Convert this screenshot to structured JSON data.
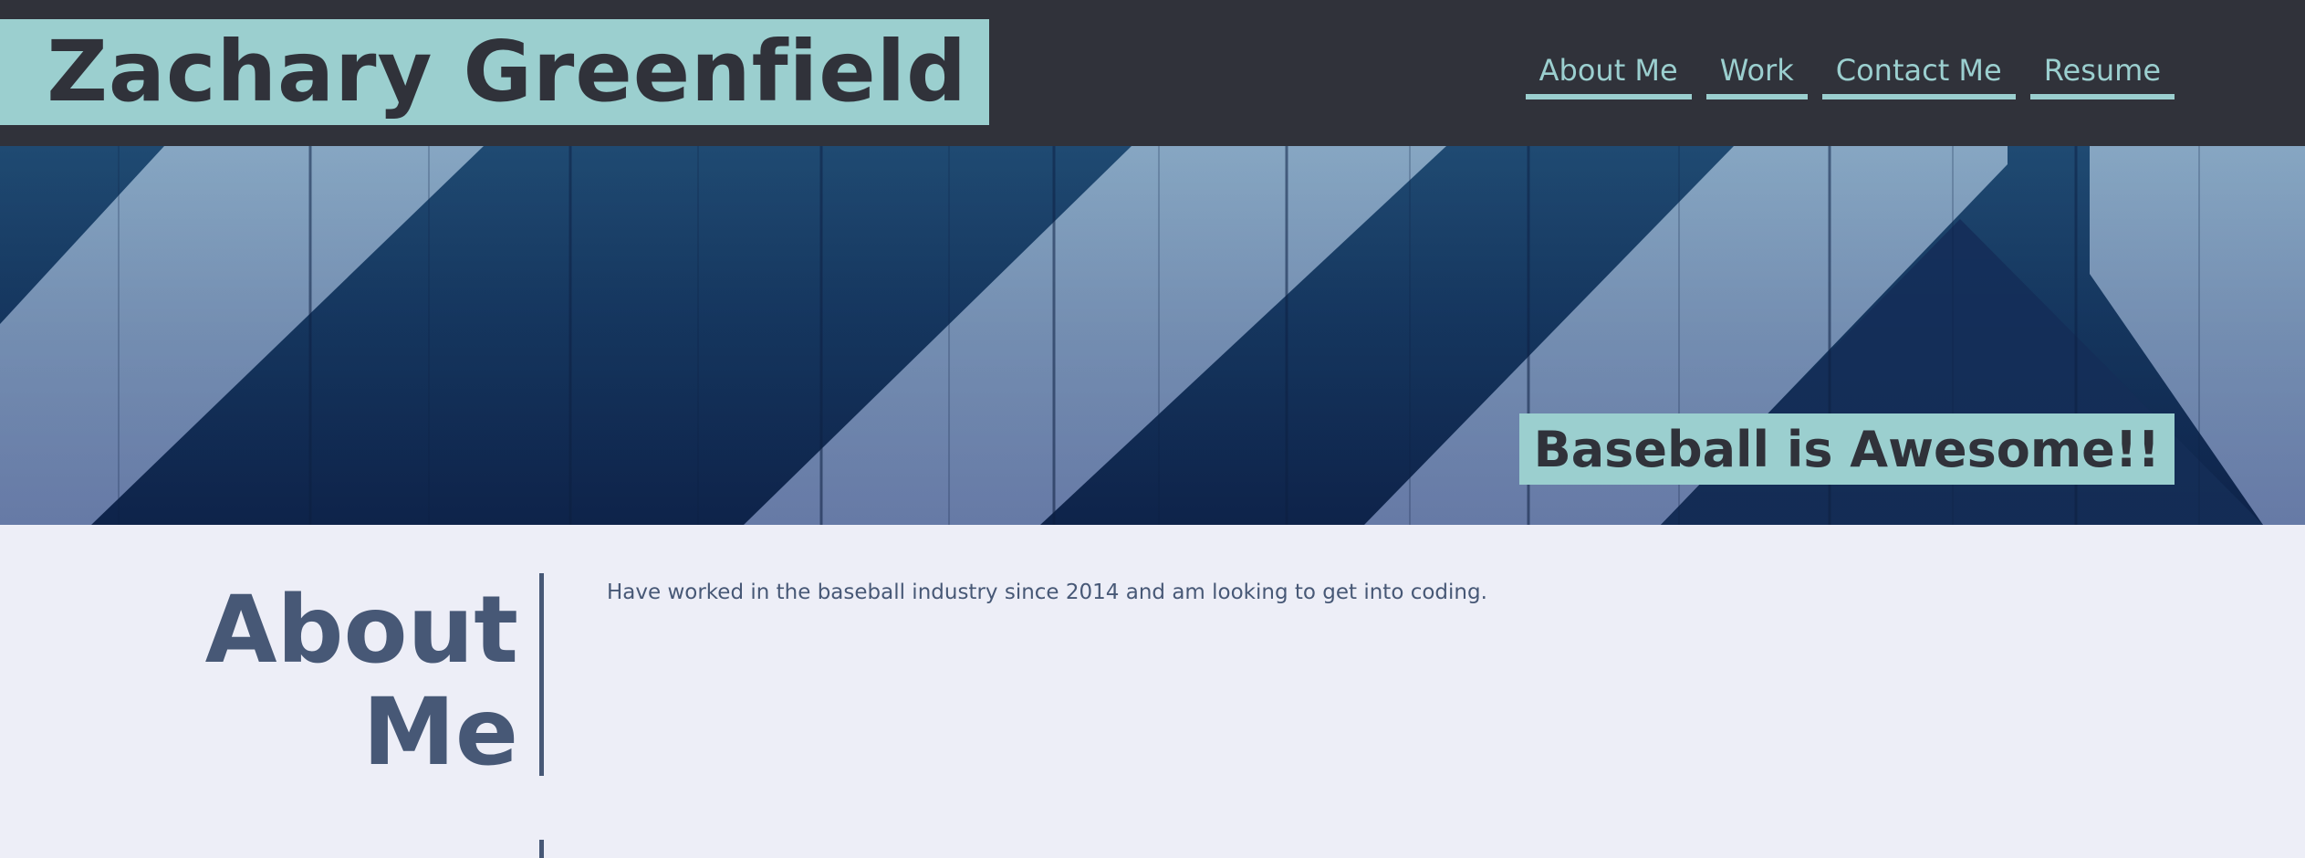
{
  "header": {
    "site_title": "Zachary Greenfield",
    "nav": [
      {
        "label": "About Me"
      },
      {
        "label": "Work"
      },
      {
        "label": "Contact Me"
      },
      {
        "label": "Resume"
      }
    ]
  },
  "hero": {
    "tagline": "Baseball is Awesome!!"
  },
  "about": {
    "heading_line1": "About",
    "heading_line2": "Me",
    "text": "Have worked in the baseball industry since 2014 and am looking to get into coding."
  },
  "colors": {
    "header_bg": "#30323a",
    "accent": "#9bcfcf",
    "content_bg": "#edeef7",
    "heading": "#475876"
  }
}
